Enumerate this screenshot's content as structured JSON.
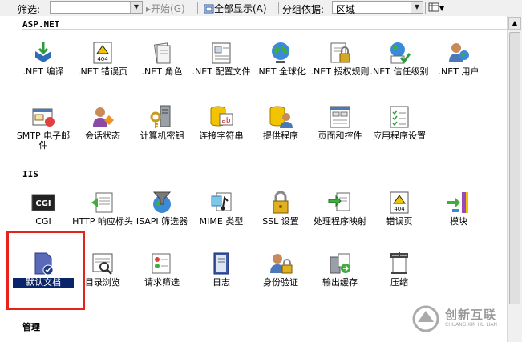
{
  "toolbar": {
    "filter_label": "筛选:",
    "start_label": "开始(G)",
    "show_all_label": "全部显示(A)",
    "group_by_label": "分组依据:",
    "group_by_value": "区域"
  },
  "groups": [
    {
      "title": "ASP.NET",
      "items": [
        {
          "label": ".NET 编译",
          "icon": "compile-icon"
        },
        {
          "label": ".NET 错误页",
          "icon": "error-page-icon"
        },
        {
          "label": ".NET 角色",
          "icon": "roles-icon"
        },
        {
          "label": ".NET 配置文件",
          "icon": "profile-icon"
        },
        {
          "label": ".NET 全球化",
          "icon": "globe-icon"
        },
        {
          "label": ".NET 授权规则",
          "icon": "authorization-icon"
        },
        {
          "label": ".NET 信任级别",
          "icon": "trust-level-icon"
        },
        {
          "label": ".NET 用户",
          "icon": "users-icon"
        },
        {
          "label": "SMTP 电子邮件",
          "icon": "smtp-icon"
        },
        {
          "label": "会话状态",
          "icon": "session-state-icon"
        },
        {
          "label": "计算机密钥",
          "icon": "machine-key-icon"
        },
        {
          "label": "连接字符串",
          "icon": "connection-string-icon"
        },
        {
          "label": "提供程序",
          "icon": "providers-icon"
        },
        {
          "label": "页面和控件",
          "icon": "pages-controls-icon"
        },
        {
          "label": "应用程序设置",
          "icon": "app-settings-icon"
        }
      ]
    },
    {
      "title": "IIS",
      "items": [
        {
          "label": "CGI",
          "icon": "cgi-icon"
        },
        {
          "label": "HTTP 响应标头",
          "icon": "http-headers-icon"
        },
        {
          "label": "ISAPI 筛选器",
          "icon": "isapi-filter-icon"
        },
        {
          "label": "MIME 类型",
          "icon": "mime-icon"
        },
        {
          "label": "SSL 设置",
          "icon": "ssl-icon"
        },
        {
          "label": "处理程序映射",
          "icon": "handler-mappings-icon"
        },
        {
          "label": "错误页",
          "icon": "error-pages-icon"
        },
        {
          "label": "模块",
          "icon": "modules-icon"
        },
        {
          "label": "默认文档",
          "icon": "default-document-icon"
        },
        {
          "label": "目录浏览",
          "icon": "directory-browsing-icon"
        },
        {
          "label": "请求筛选",
          "icon": "request-filtering-icon"
        },
        {
          "label": "日志",
          "icon": "logging-icon"
        },
        {
          "label": "身份验证",
          "icon": "authentication-icon"
        },
        {
          "label": "输出缓存",
          "icon": "output-cache-icon"
        },
        {
          "label": "压缩",
          "icon": "compression-icon"
        }
      ]
    },
    {
      "title": "管理",
      "items": []
    }
  ],
  "watermark": {
    "name": "创新互联",
    "sub": "CHUANG XIN HU LIAN"
  },
  "colors": {
    "selection": "#0a246a",
    "highlight_border": "#e8221a"
  }
}
